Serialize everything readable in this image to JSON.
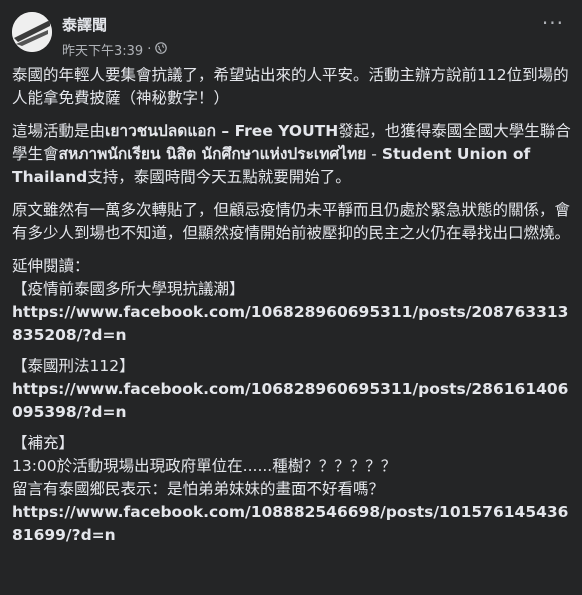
{
  "post": {
    "page_name": "泰譯聞",
    "timestamp": "昨天下午3:39",
    "separator": "·",
    "more_label": "···",
    "p1": "泰國的年輕人要集會抗議了，希望站出來的人平安。活動主辦方說前112位到場的人能拿免費披薩（神秘數字！）",
    "p2_a": "這場活動是由",
    "p2_thai1": "เยาวชนปลดแอก",
    "p2_b": " – ",
    "p2_free": "Free YOUTH",
    "p2_c": "發起，也獲得泰國全國大學生聯合學生會",
    "p2_thai2": "สหภาพนักเรียน นิสิต นักศึกษาแห่งประเทศไทย",
    "p2_d": " - ",
    "p2_su": "Student Union of Thailand",
    "p2_e": "支持，泰國時間今天五點就要開始了。",
    "p3": "原文雖然有一萬多次轉貼了，但顧忌疫情仍未平靜而且仍處於緊急狀態的關係，會有多少人到場也不知道，但顯然疫情開始前被壓抑的民主之火仍在尋找出口燃燒。",
    "further_title": "延伸閱讀：",
    "link1_title": "【疫情前泰國多所大學現抗議潮】",
    "link1_url": "https://www.facebook.com/106828960695311/posts/208763313835208/?d=n",
    "link2_title": "【泰國刑法112】",
    "link2_url": "https://www.facebook.com/106828960695311/posts/286161406095398/?d=n",
    "supp_title": "【補充】",
    "supp_line1": "13:00於活動現場出現政府單位在......種樹？？？？？？",
    "supp_line2": "留言有泰國鄉民表示：是怕弟弟妹妹的畫面不好看嗎？",
    "link3_url": "https://www.facebook.com/108882546698/posts/10157614543681699/?d=n"
  }
}
